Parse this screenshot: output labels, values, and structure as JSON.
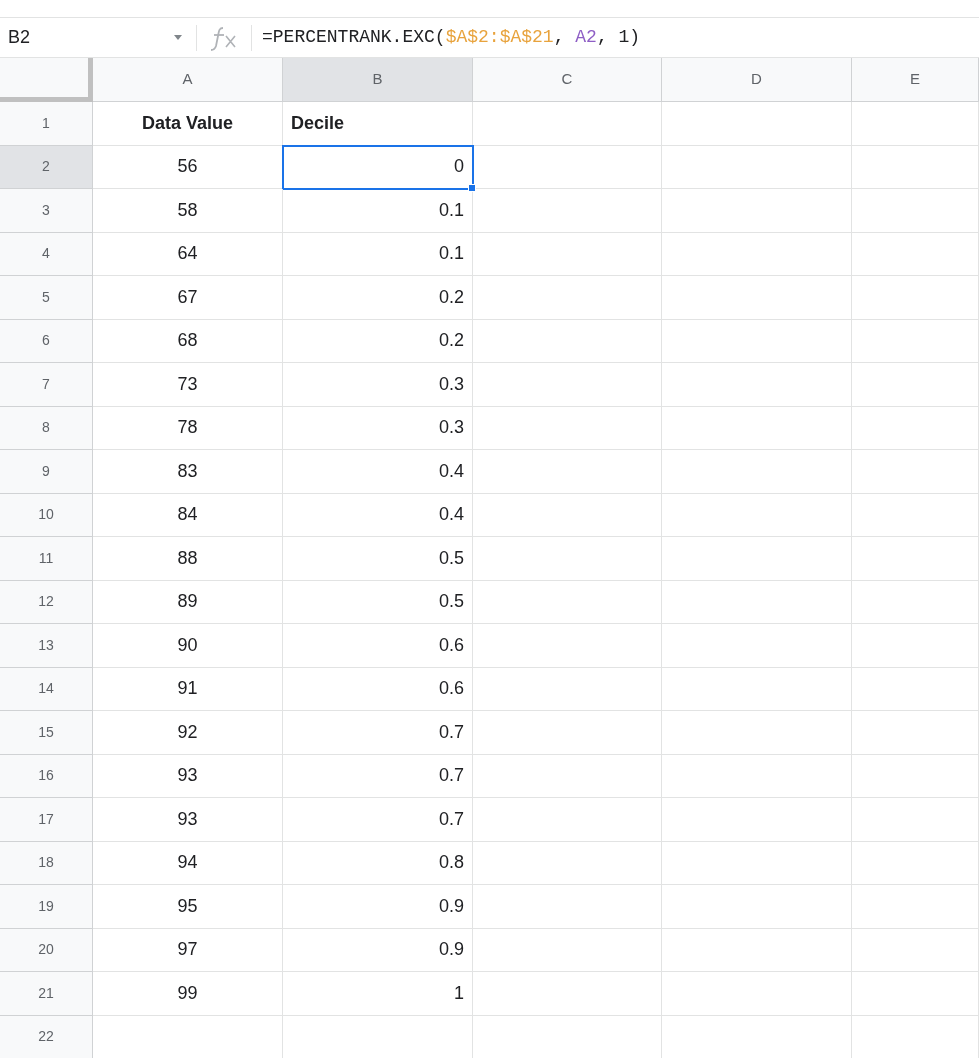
{
  "formula_bar": {
    "cell_ref": "B2",
    "formula": [
      {
        "text": "=PERCENTRANK.EXC(",
        "kind": "plain"
      },
      {
        "text": "$A$2:$A$21",
        "kind": "range"
      },
      {
        "text": ", ",
        "kind": "plain"
      },
      {
        "text": "A2",
        "kind": "ref"
      },
      {
        "text": ", ",
        "kind": "plain"
      },
      {
        "text": "1",
        "kind": "number"
      },
      {
        "text": ")",
        "kind": "plain"
      }
    ]
  },
  "columns": [
    {
      "label": "A",
      "selected": false
    },
    {
      "label": "B",
      "selected": true
    },
    {
      "label": "C",
      "selected": false
    },
    {
      "label": "D",
      "selected": false
    },
    {
      "label": "E",
      "selected": false
    }
  ],
  "rows": [
    {
      "label": "1",
      "selected": false,
      "kind": "header",
      "cells": [
        {
          "text": "Data Value",
          "selected": false
        },
        {
          "text": "Decile",
          "selected": false
        }
      ]
    },
    {
      "label": "2",
      "selected": true,
      "kind": "data",
      "cells": [
        {
          "text": "56",
          "selected": false
        },
        {
          "text": "0",
          "selected": true
        }
      ]
    },
    {
      "label": "3",
      "selected": false,
      "kind": "data",
      "cells": [
        {
          "text": "58",
          "selected": false
        },
        {
          "text": "0.1",
          "selected": false
        }
      ]
    },
    {
      "label": "4",
      "selected": false,
      "kind": "data",
      "cells": [
        {
          "text": "64",
          "selected": false
        },
        {
          "text": "0.1",
          "selected": false
        }
      ]
    },
    {
      "label": "5",
      "selected": false,
      "kind": "data",
      "cells": [
        {
          "text": "67",
          "selected": false
        },
        {
          "text": "0.2",
          "selected": false
        }
      ]
    },
    {
      "label": "6",
      "selected": false,
      "kind": "data",
      "cells": [
        {
          "text": "68",
          "selected": false
        },
        {
          "text": "0.2",
          "selected": false
        }
      ]
    },
    {
      "label": "7",
      "selected": false,
      "kind": "data",
      "cells": [
        {
          "text": "73",
          "selected": false
        },
        {
          "text": "0.3",
          "selected": false
        }
      ]
    },
    {
      "label": "8",
      "selected": false,
      "kind": "data",
      "cells": [
        {
          "text": "78",
          "selected": false
        },
        {
          "text": "0.3",
          "selected": false
        }
      ]
    },
    {
      "label": "9",
      "selected": false,
      "kind": "data",
      "cells": [
        {
          "text": "83",
          "selected": false
        },
        {
          "text": "0.4",
          "selected": false
        }
      ]
    },
    {
      "label": "10",
      "selected": false,
      "kind": "data",
      "cells": [
        {
          "text": "84",
          "selected": false
        },
        {
          "text": "0.4",
          "selected": false
        }
      ]
    },
    {
      "label": "11",
      "selected": false,
      "kind": "data",
      "cells": [
        {
          "text": "88",
          "selected": false
        },
        {
          "text": "0.5",
          "selected": false
        }
      ]
    },
    {
      "label": "12",
      "selected": false,
      "kind": "data",
      "cells": [
        {
          "text": "89",
          "selected": false
        },
        {
          "text": "0.5",
          "selected": false
        }
      ]
    },
    {
      "label": "13",
      "selected": false,
      "kind": "data",
      "cells": [
        {
          "text": "90",
          "selected": false
        },
        {
          "text": "0.6",
          "selected": false
        }
      ]
    },
    {
      "label": "14",
      "selected": false,
      "kind": "data",
      "cells": [
        {
          "text": "91",
          "selected": false
        },
        {
          "text": "0.6",
          "selected": false
        }
      ]
    },
    {
      "label": "15",
      "selected": false,
      "kind": "data",
      "cells": [
        {
          "text": "92",
          "selected": false
        },
        {
          "text": "0.7",
          "selected": false
        }
      ]
    },
    {
      "label": "16",
      "selected": false,
      "kind": "data",
      "cells": [
        {
          "text": "93",
          "selected": false
        },
        {
          "text": "0.7",
          "selected": false
        }
      ]
    },
    {
      "label": "17",
      "selected": false,
      "kind": "data",
      "cells": [
        {
          "text": "93",
          "selected": false
        },
        {
          "text": "0.7",
          "selected": false
        }
      ]
    },
    {
      "label": "18",
      "selected": false,
      "kind": "data",
      "cells": [
        {
          "text": "94",
          "selected": false
        },
        {
          "text": "0.8",
          "selected": false
        }
      ]
    },
    {
      "label": "19",
      "selected": false,
      "kind": "data",
      "cells": [
        {
          "text": "95",
          "selected": false
        },
        {
          "text": "0.9",
          "selected": false
        }
      ]
    },
    {
      "label": "20",
      "selected": false,
      "kind": "data",
      "cells": [
        {
          "text": "97",
          "selected": false
        },
        {
          "text": "0.9",
          "selected": false
        }
      ]
    },
    {
      "label": "21",
      "selected": false,
      "kind": "data",
      "cells": [
        {
          "text": "99",
          "selected": false
        },
        {
          "text": "1",
          "selected": false
        }
      ]
    },
    {
      "label": "22",
      "selected": false,
      "kind": "data"
    }
  ]
}
